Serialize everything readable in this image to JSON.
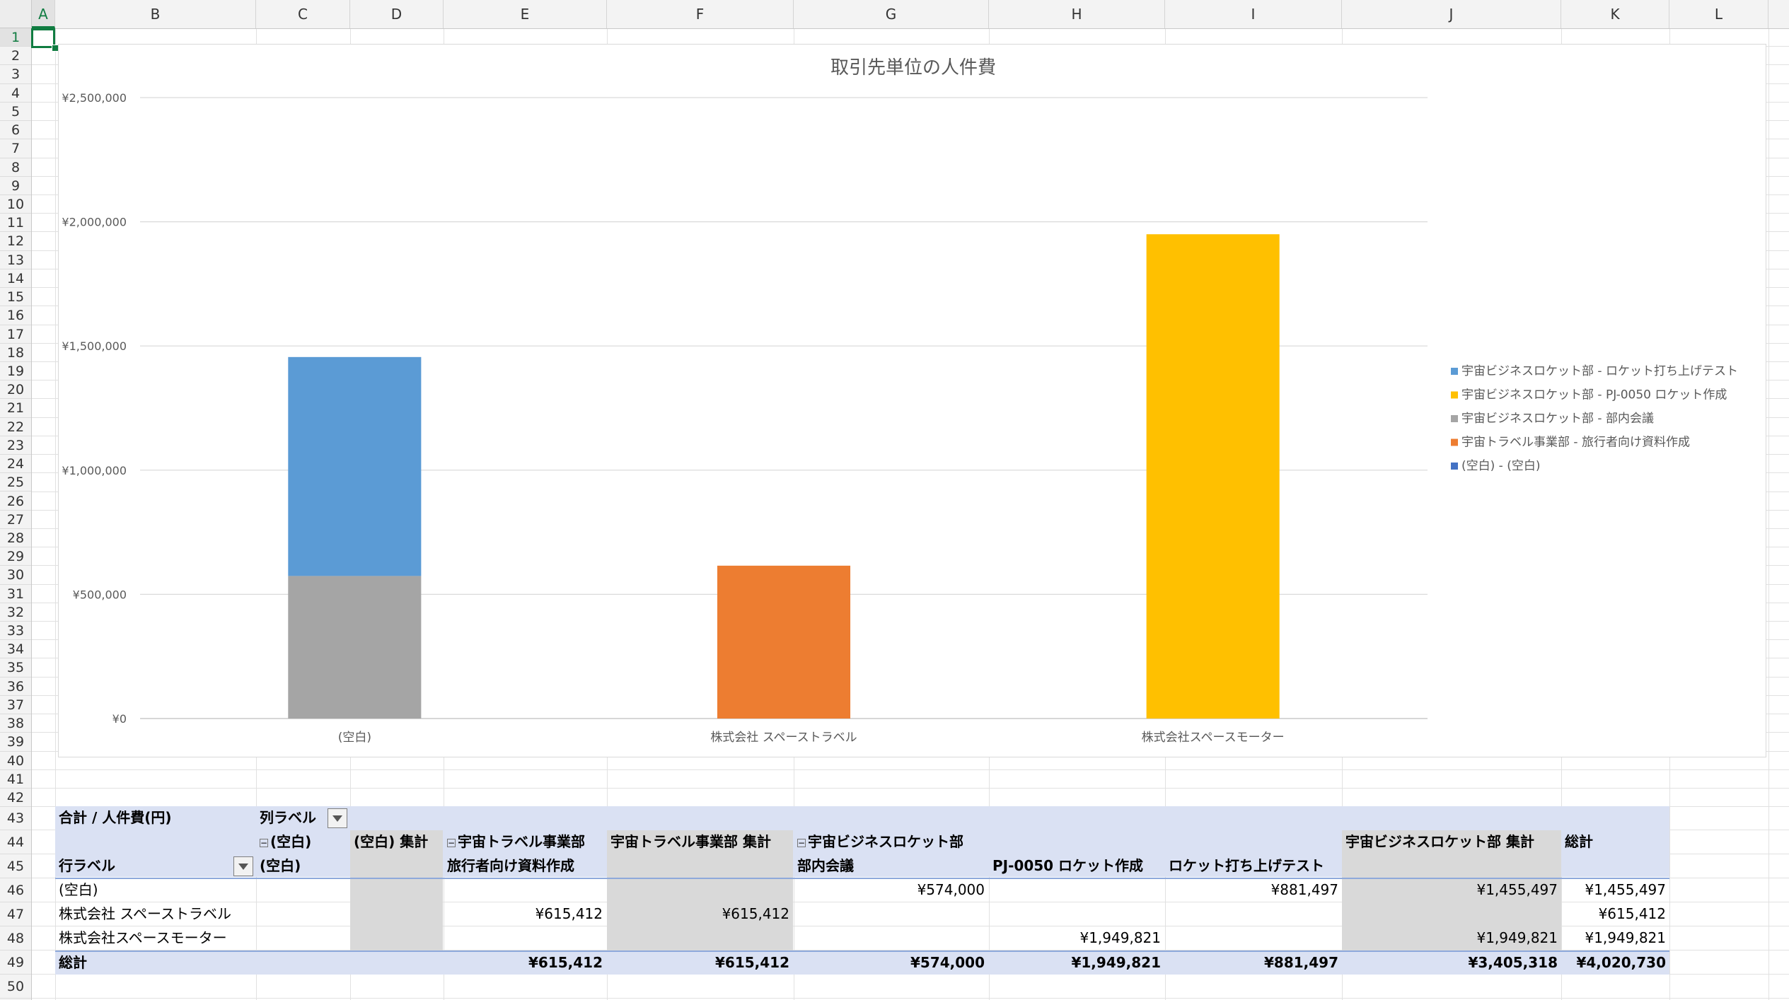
{
  "columns": [
    "A",
    "B",
    "C",
    "D",
    "E",
    "F",
    "G",
    "H",
    "I",
    "J",
    "K",
    "L"
  ],
  "rows": [
    "1",
    "2",
    "3",
    "4",
    "5",
    "6",
    "7",
    "8",
    "9",
    "10",
    "11",
    "12",
    "13",
    "14",
    "15",
    "16",
    "17",
    "18",
    "19",
    "20",
    "21",
    "22",
    "23",
    "24",
    "25",
    "26",
    "27",
    "28",
    "29",
    "30",
    "31",
    "32",
    "33",
    "34",
    "35",
    "36",
    "37",
    "38",
    "39",
    "40",
    "41",
    "42",
    "43",
    "44",
    "45",
    "46",
    "47",
    "48",
    "49",
    "50"
  ],
  "selected_cell": "A1",
  "colors": {
    "blue": "#5b9bd5",
    "orange": "#ed7d31",
    "gray": "#a5a5a5",
    "gold": "#ffc000",
    "darkblue": "#4472c4",
    "pivot_band": "#dae1f3",
    "pivot_gray": "#d9d9d9",
    "excel_green": "#107c41"
  },
  "chart_data": {
    "type": "bar",
    "stacked": true,
    "title": "取引先単位の人件費",
    "categories": [
      "(空白)",
      "株式会社 スペーストラベル",
      "株式会社スペースモーター"
    ],
    "series": [
      {
        "name": "宇宙ビジネスロケット部 - ロケット打ち上げテスト",
        "color": "#5b9bd5",
        "values": [
          881497,
          0,
          0
        ]
      },
      {
        "name": "宇宙ビジネスロケット部 - PJ-0050 ロケット作成",
        "color": "#ffc000",
        "values": [
          0,
          0,
          1949821
        ]
      },
      {
        "name": "宇宙ビジネスロケット部 - 部内会議",
        "color": "#a5a5a5",
        "values": [
          574000,
          0,
          0
        ]
      },
      {
        "name": "宇宙トラベル事業部 - 旅行者向け資料作成",
        "color": "#ed7d31",
        "values": [
          0,
          615412,
          0
        ]
      },
      {
        "name": "(空白) - (空白)",
        "color": "#4472c4",
        "values": [
          0,
          0,
          0
        ]
      }
    ],
    "stack_order": [
      2,
      3,
      1,
      0,
      4
    ],
    "yticks": [
      "¥0",
      "¥500,000",
      "¥1,000,000",
      "¥1,500,000",
      "¥2,000,000",
      "¥2,500,000"
    ],
    "ylim": [
      0,
      2500000
    ],
    "legend": "right",
    "grid": true
  },
  "pivot": {
    "header": {
      "sum_label": "合計 / 人件費(円)",
      "col_label": "列ラベル",
      "row_label": "行ラベル",
      "blank_group": "(空白)",
      "blank_sub": "(空白)",
      "blank_total": "(空白) 集計",
      "travel_group": "宇宙トラベル事業部",
      "travel_sub": "旅行者向け資料作成",
      "travel_total": "宇宙トラベル事業部 集計",
      "rocket_group": "宇宙ビジネスロケット部",
      "rocket_sub1": "部内会議",
      "rocket_sub2": "PJ-0050 ロケット作成",
      "rocket_sub3": "ロケット打ち上げテスト",
      "rocket_total": "宇宙ビジネスロケット部 集計",
      "grand_total": "総計"
    },
    "rows": [
      {
        "label": "(空白)",
        "travel": "",
        "travel_total": "",
        "meeting": "¥574,000",
        "pj0050": "",
        "launch": "¥881,497",
        "rocket_total": "¥1,455,497",
        "grand": "¥1,455,497"
      },
      {
        "label": "株式会社 スペーストラベル",
        "travel": "¥615,412",
        "travel_total": "¥615,412",
        "meeting": "",
        "pj0050": "",
        "launch": "",
        "rocket_total": "",
        "grand": "¥615,412"
      },
      {
        "label": "株式会社スペースモーター",
        "travel": "",
        "travel_total": "",
        "meeting": "",
        "pj0050": "¥1,949,821",
        "launch": "",
        "rocket_total": "¥1,949,821",
        "grand": "¥1,949,821"
      }
    ],
    "total": {
      "label": "総計",
      "travel": "¥615,412",
      "travel_total": "¥615,412",
      "meeting": "¥574,000",
      "pj0050": "¥1,949,821",
      "launch": "¥881,497",
      "rocket_total": "¥3,405,318",
      "grand": "¥4,020,730"
    }
  }
}
